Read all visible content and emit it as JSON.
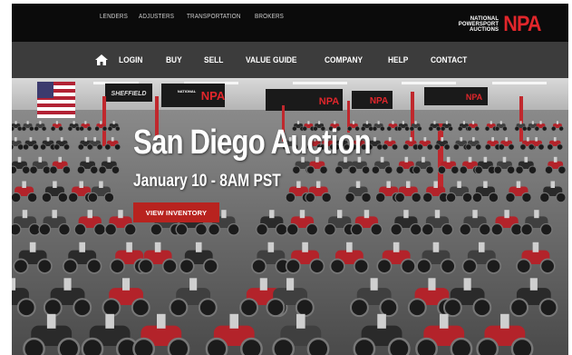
{
  "utility_nav": {
    "links": [
      "LENDERS",
      "ADJUSTERS",
      "TRANSPORTATION",
      "BROKERS"
    ]
  },
  "logo": {
    "line1": "NATIONAL",
    "line2": "POWERSPORT",
    "line3": "AUCTIONS",
    "mark": "NPA"
  },
  "main_nav": {
    "home_icon": "home-icon",
    "items": [
      "LOGIN",
      "BUY",
      "SELL",
      "VALUE GUIDE",
      "COMPANY",
      "HELP",
      "CONTACT"
    ]
  },
  "hero": {
    "title": "San Diego Auction",
    "date": "January 10 - 8AM PST",
    "cta_label": "VIEW INVENTORY",
    "banner_texts": [
      "SHEFFIELD",
      "NATIONAL POWERSPORT AUCTIONS",
      "NPA",
      "NPA",
      "NPA",
      "NPA"
    ]
  },
  "colors": {
    "brand_red": "#e1262b",
    "cta_red": "#b8231f",
    "topbar": "#0b0b0b",
    "navbar": "#3c3c3c"
  }
}
